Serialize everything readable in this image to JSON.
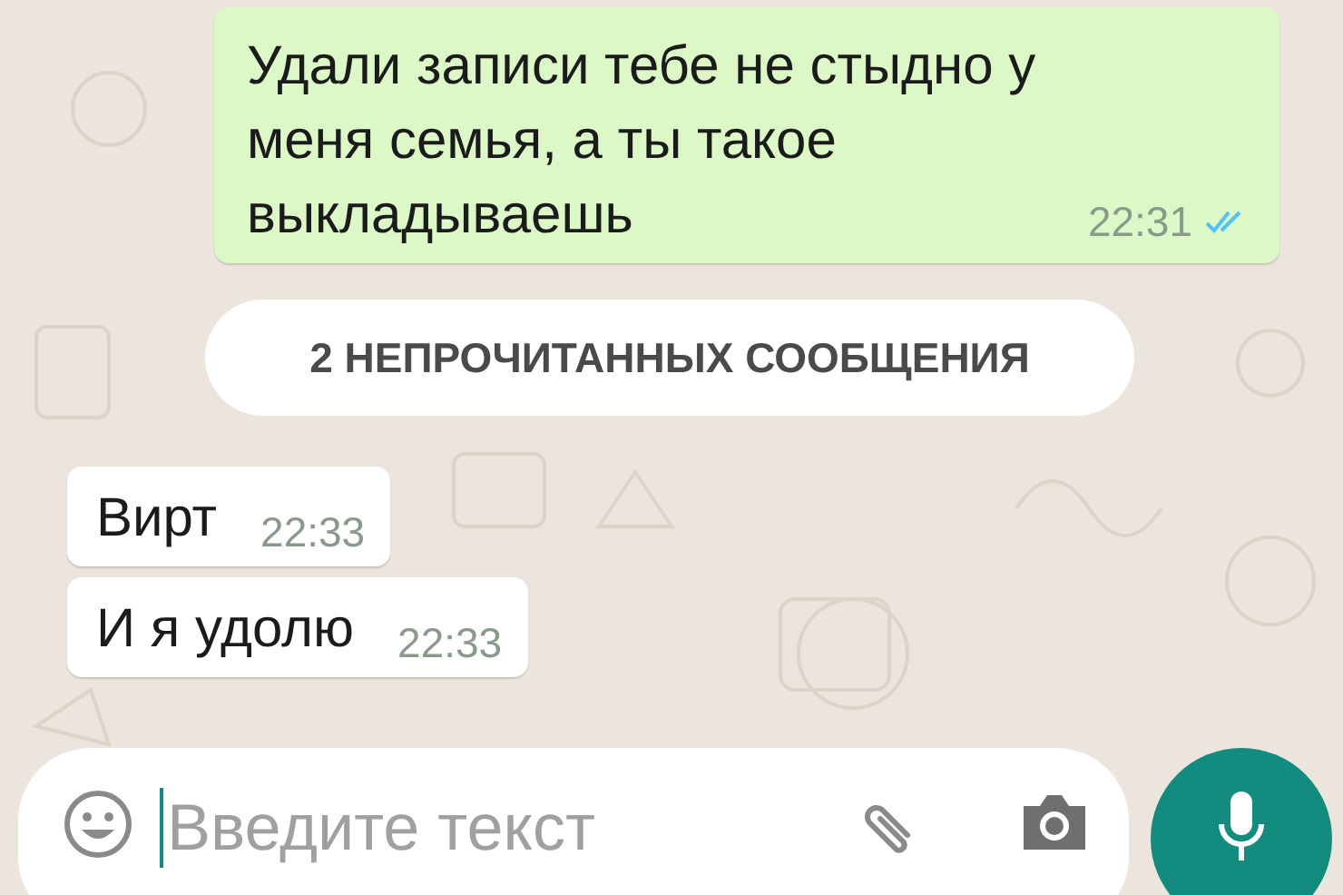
{
  "chat": [
    {
      "kind": "outgoing",
      "text": "Удали записи тебе не стыдно у меня семья, а ты такое выкладываешь",
      "time": "22:31",
      "read": true
    },
    {
      "kind": "banner",
      "text": "2 НЕПРОЧИТАННЫХ СООБЩЕНИЯ"
    },
    {
      "kind": "incoming",
      "text": "Вирт",
      "time": "22:33"
    },
    {
      "kind": "incoming",
      "text": "И я удолю",
      "time": "22:33"
    }
  ],
  "composer": {
    "placeholder": "Введите текст"
  }
}
